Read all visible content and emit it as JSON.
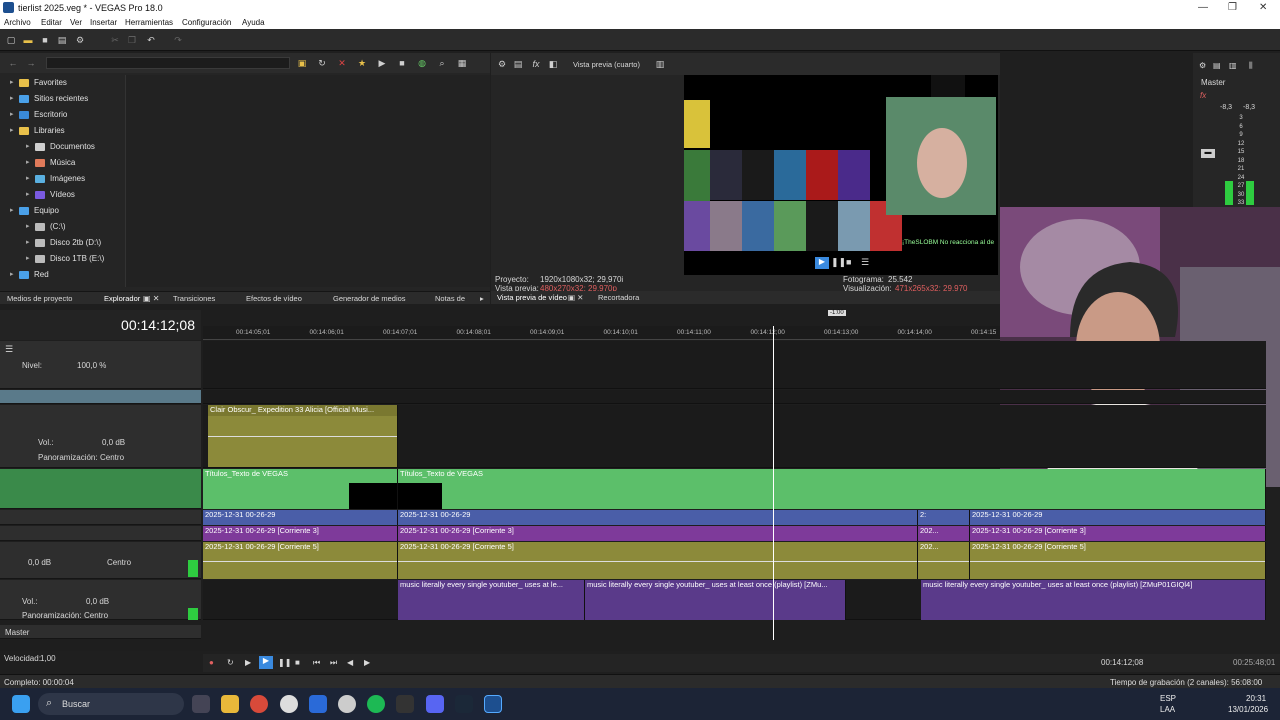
{
  "window": {
    "title": "tierlist 2025.veg * - VEGAS Pro 18.0",
    "min": "—",
    "max": "❐",
    "close": "✕"
  },
  "menu": [
    "Archivo",
    "Editar",
    "Ver",
    "Insertar",
    "Herramientas",
    "Configuración",
    "Ayuda"
  ],
  "explorer": {
    "tree": [
      {
        "label": "Favorites",
        "level": 0,
        "color": "#e8c04a"
      },
      {
        "label": "Sitios recientes",
        "level": 0,
        "color": "#4aa0e8"
      },
      {
        "label": "Escritorio",
        "level": 0,
        "color": "#3a8ad8"
      },
      {
        "label": "Libraries",
        "level": 0,
        "color": "#e8c04a"
      },
      {
        "label": "Documentos",
        "level": 1,
        "color": "#cfcfcf"
      },
      {
        "label": "Música",
        "level": 1,
        "color": "#e07a5a"
      },
      {
        "label": "Imágenes",
        "level": 1,
        "color": "#5ab0e0"
      },
      {
        "label": "Vídeos",
        "level": 1,
        "color": "#7a5ae0"
      },
      {
        "label": "Equipo",
        "level": 0,
        "color": "#4aa0e8"
      },
      {
        "label": "(C:\\)",
        "level": 1,
        "color": "#bbbbbb"
      },
      {
        "label": "Disco 2tb (D:\\)",
        "level": 1,
        "color": "#bbbbbb"
      },
      {
        "label": "Disco 1TB (E:\\)",
        "level": 1,
        "color": "#bbbbbb"
      },
      {
        "label": "Red",
        "level": 0,
        "color": "#4aa0e8"
      }
    ],
    "tabs": [
      "Medios de proyecto",
      "Explorador",
      "Transiciones",
      "Efectos de vídeo",
      "Generador de medios",
      "Notas de"
    ]
  },
  "preview": {
    "mode": "Vista previa (cuarto)",
    "proyecto_label": "Proyecto:",
    "proyecto": "1920x1080x32; 29,970i",
    "vista_label": "Vista previa:",
    "vista": "480x270x32; 29,970p",
    "fotograma_label": "Fotograma:",
    "fotograma": "25.542",
    "visual_label": "Visualización:",
    "visual": "471x265x32; 29,970",
    "tabs": [
      "Vista previa de vídeo",
      "Recortadora"
    ],
    "overlay_text": "¡TheSLOBM  No reacciona al de"
  },
  "master": {
    "label": "Master",
    "l": "-8,3",
    "r": "-8,3",
    "scale": [
      "3",
      "6",
      "9",
      "12",
      "15",
      "18",
      "21",
      "24",
      "27",
      "30",
      "33"
    ]
  },
  "timeline": {
    "timecode": "00:14:12;08",
    "ruler": [
      "00:14:05;01",
      "00:14:06;01",
      "00:14:07;01",
      "00:14:08;01",
      "00:14:09;01",
      "00:14:10;01",
      "00:14:11;00",
      "00:14:12;00",
      "00:14:13;00",
      "00:14:14;00",
      "00:14:15"
    ],
    "marker": "-1:00",
    "nivel_label": "Nivel:",
    "nivel": "100,0 %",
    "vol_label": "Vol.:",
    "vol": "0,0 dB",
    "pan_label": "Panoramización:",
    "pan": "Centro",
    "t5_db": "0,0 dB",
    "t5_pan": "Centro",
    "clips": {
      "a1": "Clair Obscur_ Expedition 33  Alicia [Official Musi...",
      "t1": "Títulos_Texto de VEGAS",
      "t2": "Títulos_Texto de VEGAS",
      "v1": "2025-12-31 00-26-29",
      "v2": "2025-12-31 00-26-29",
      "v3": "2025-12-31 00-26-29",
      "v3b": "2:",
      "c3a": "2025-12-31 00-26-29 [Corriente 3]",
      "c3b": "2025-12-31 00-26-29 [Corriente 3]",
      "c3c": "2025-12-31 00-26-29 [Corriente 3]",
      "c5a": "2025-12-31 00-26-29 [Corriente 5]",
      "c5b": "2025-12-31 00-26-29 [Corriente 5]",
      "c5mid": "202...",
      "c5c": "2025-12-31 00-26-29 [Corriente 5]",
      "c3mid": "202...",
      "m1": "music literally every single youtuber_ uses at le...",
      "m2": "music literally every single youtuber_ uses at least once (playlist) [ZMu...",
      "m3": "music literally every single youtuber_ uses at least once (playlist) [ZMuP01GIQl4]"
    },
    "master_label": "Master",
    "speed_label": "Velocidad:",
    "speed": "1,00",
    "pos": "00:14:12;08",
    "len": "00:25:48;01"
  },
  "status": {
    "left": "Completo: 00:00:04",
    "right": "Tiempo de grabación (2 canales): 56:08:00"
  },
  "taskbar": {
    "search": "Buscar",
    "lang1": "ESP",
    "lang2": "LAA",
    "time": "20:31",
    "date": "13/01/2026"
  }
}
